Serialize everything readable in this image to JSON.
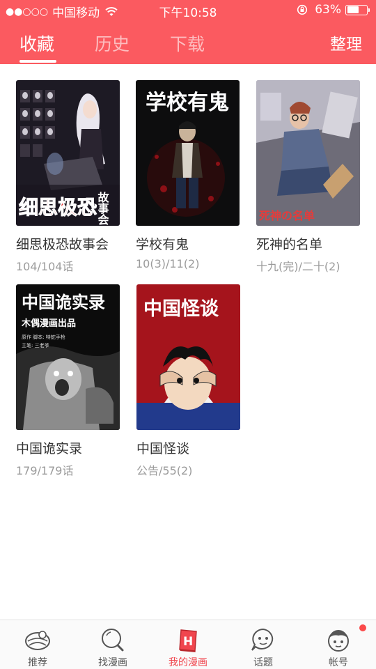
{
  "colors": {
    "accent": "#fb5a60",
    "active_tab_label": "#f0464e",
    "title_text": "#333333",
    "sub_text": "#9b9b9b"
  },
  "status_bar": {
    "signal": "●●○○○",
    "carrier": "中国移动",
    "time": "下午10:58",
    "battery": "63%",
    "battery_level": 0.63
  },
  "header": {
    "tabs": [
      {
        "label": "收藏",
        "active": true
      },
      {
        "label": "历史",
        "active": false
      },
      {
        "label": "下载",
        "active": false
      }
    ],
    "action_label": "整理"
  },
  "comics": [
    {
      "title": "细思极恐故事会",
      "progress": "104/104话",
      "cover_text": "细思极恐",
      "cover_text2": "故事会"
    },
    {
      "title": "学校有鬼",
      "progress": "10(3)/11(2)",
      "cover_text": "学校有鬼"
    },
    {
      "title": "死神的名单",
      "progress": "十九(完)/二十(2)",
      "cover_text": "死神の名单"
    },
    {
      "title": "中国诡实录",
      "progress": "179/179话",
      "cover_text": "中国诡实录",
      "cover_text2": "木偶漫画出品",
      "cover_text3": "原作 脚本: 特蛇手枪",
      "cover_text4": "主笔: 三老爷"
    },
    {
      "title": "中国怪谈",
      "progress": "公告/55(2)",
      "cover_text": "中国怪谈"
    }
  ],
  "tabbar": [
    {
      "label": "推荐",
      "icon": "recommend-icon"
    },
    {
      "label": "找漫画",
      "icon": "search-icon"
    },
    {
      "label": "我的漫画",
      "icon": "my-comics-icon",
      "active": true
    },
    {
      "label": "话题",
      "icon": "topic-icon"
    },
    {
      "label": "帐号",
      "icon": "account-icon",
      "badge": true
    }
  ]
}
